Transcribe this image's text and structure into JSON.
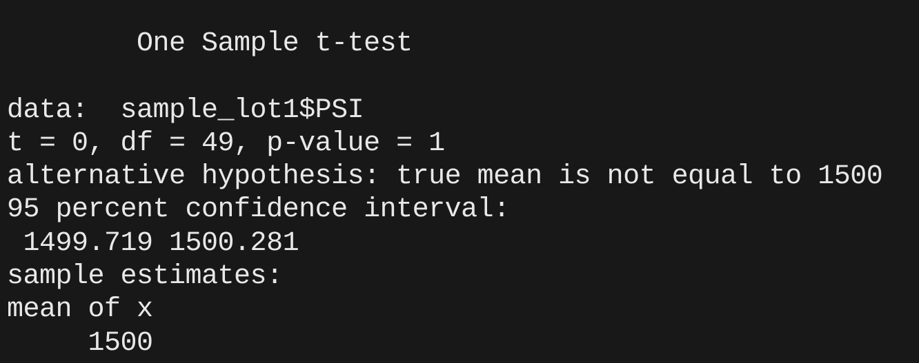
{
  "console": {
    "lines": [
      "        One Sample t-test",
      "",
      "data:  sample_lot1$PSI",
      "t = 0, df = 49, p-value = 1",
      "alternative hypothesis: true mean is not equal to 1500",
      "95 percent confidence interval:",
      " 1499.719 1500.281",
      "sample estimates:",
      "mean of x",
      "     1500"
    ]
  },
  "colors": {
    "background": "#181818",
    "text": "#e8e8e8"
  }
}
